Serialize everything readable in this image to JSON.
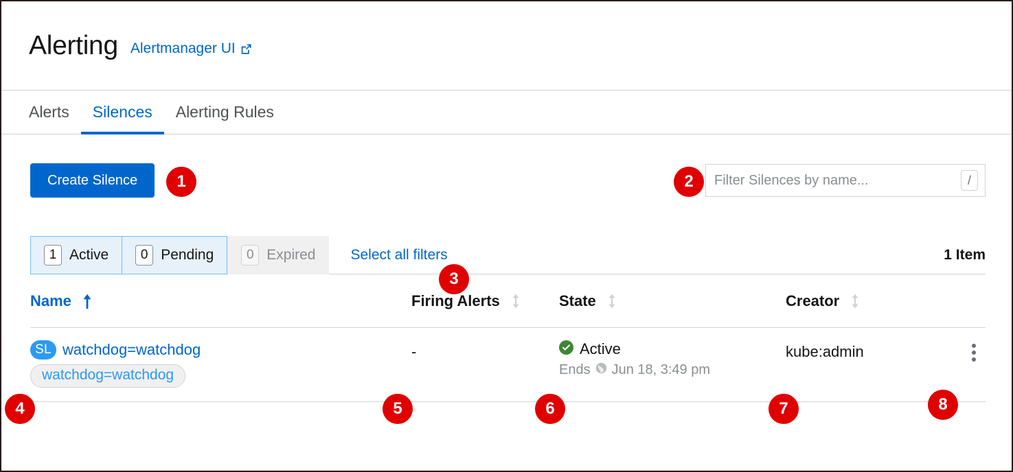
{
  "header": {
    "title": "Alerting",
    "link_label": "Alertmanager UI",
    "link_icon": "external-link-icon"
  },
  "tabs": [
    {
      "label": "Alerts",
      "active": false
    },
    {
      "label": "Silences",
      "active": true
    },
    {
      "label": "Alerting Rules",
      "active": false
    }
  ],
  "toolbar": {
    "create_button_label": "Create Silence",
    "filter_placeholder": "Filter Silences by name...",
    "filter_value": "",
    "shortcut_key": "/"
  },
  "filters": {
    "toggles": [
      {
        "count": "1",
        "label": "Active",
        "selected": true
      },
      {
        "count": "0",
        "label": "Pending",
        "selected": true
      },
      {
        "count": "0",
        "label": "Expired",
        "selected": false
      }
    ],
    "select_all_label": "Select all filters",
    "item_count": "1 Item"
  },
  "table": {
    "columns": [
      {
        "label": "Name",
        "sorted": true,
        "sort_icon": "sort-asc-icon"
      },
      {
        "label": "Firing Alerts",
        "sorted": false,
        "sort_icon": "sort-both-icon"
      },
      {
        "label": "State",
        "sorted": false,
        "sort_icon": "sort-both-icon"
      },
      {
        "label": "Creator",
        "sorted": false,
        "sort_icon": "sort-both-icon"
      }
    ],
    "rows": [
      {
        "badge": "SL",
        "name": "watchdog=watchdog",
        "label_chip": "watchdog=watchdog",
        "firing_alerts": "-",
        "state": "Active",
        "state_icon": "check-circle-icon",
        "ends_label": "Ends",
        "ends_icon": "globe-icon",
        "ends_time": "Jun 18, 3:49 pm",
        "creator": "kube:admin",
        "kebab_icon": "kebab-menu-icon"
      }
    ]
  },
  "annotations": [
    {
      "id": "1"
    },
    {
      "id": "2"
    },
    {
      "id": "3"
    },
    {
      "id": "4"
    },
    {
      "id": "5"
    },
    {
      "id": "6"
    },
    {
      "id": "7"
    },
    {
      "id": "8"
    }
  ],
  "colors": {
    "accent_blue": "#0066cc",
    "badge_red": "#e00000",
    "success_green": "#3e8635",
    "chip_blue": "#2b9af3"
  }
}
